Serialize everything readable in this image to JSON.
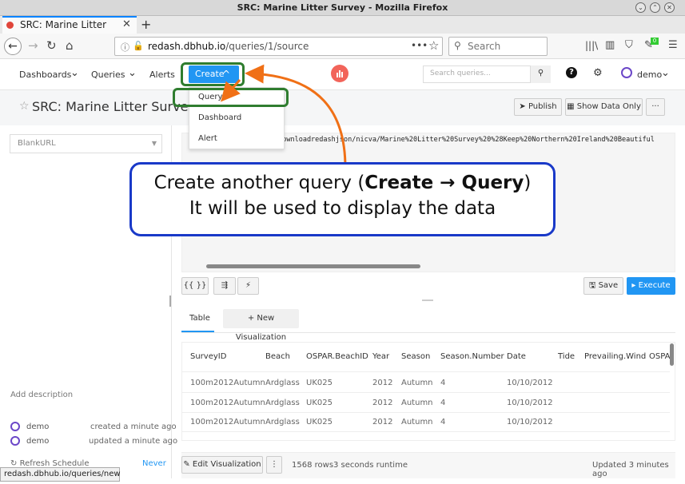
{
  "window": {
    "title": "SRC: Marine Litter Survey - Mozilla Firefox"
  },
  "browser": {
    "tab_title": "SRC: Marine Litter Survey",
    "url_host": "redash.dbhub.io",
    "url_path": "/queries/1/source",
    "search_placeholder": "Search",
    "badge": "0",
    "status_url": "redash.dbhub.io/queries/new"
  },
  "app": {
    "nav": {
      "dashboards": "Dashboards",
      "queries": "Queries",
      "alerts": "Alerts",
      "create": "Create"
    },
    "search_placeholder": "Search queries...",
    "user": "demo"
  },
  "query": {
    "title": "SRC: Marine Litter Survey",
    "publish": "Publish",
    "show_data_only": "Show Data Only",
    "more": "···",
    "data_source": "BlankURL",
    "code": "/downloadredashjson/nicva/Marine%20Litter%20Survey%20%28Keep%20Northern%20Ireland%20Beautiful",
    "params_btn": "{{ }}",
    "save": "Save",
    "execute": "Execute",
    "add_description": "Add description",
    "created_by": "demo",
    "created_when": "created a minute ago",
    "updated_by": "demo",
    "updated_when": "updated a minute ago",
    "refresh_schedule": "Refresh Schedule",
    "refresh_value": "Never"
  },
  "create_menu": {
    "items": [
      "Query",
      "Dashboard",
      "Alert"
    ]
  },
  "results": {
    "tab": "Table",
    "new_vis": "+ New Visualization",
    "columns": [
      "SurveyID",
      "Beach",
      "OSPAR.BeachID",
      "Year",
      "Season",
      "Season.Number",
      "Date",
      "Tide",
      "Prevailing.Wind",
      "OSPA"
    ],
    "rows": [
      [
        "100m2012Autumn",
        "Ardglass",
        "UK025",
        "2012",
        "Autumn",
        "4",
        "10/10/2012",
        "",
        "",
        ""
      ],
      [
        "100m2012Autumn",
        "Ardglass",
        "UK025",
        "2012",
        "Autumn",
        "4",
        "10/10/2012",
        "",
        "",
        ""
      ],
      [
        "100m2012Autumn",
        "Ardglass",
        "UK025",
        "2012",
        "Autumn",
        "4",
        "10/10/2012",
        "",
        "",
        ""
      ]
    ],
    "edit_vis": "Edit Visualization",
    "rows_count": "1568 rows",
    "runtime": "3 seconds runtime",
    "updated": "Updated 3 minutes ago"
  },
  "callout": {
    "line1_prefix": "Create another query (",
    "line1_bold": "Create → Query",
    "line1_suffix": ")",
    "line2": "It will be used to display the data"
  },
  "colors": {
    "primary": "#2196f3",
    "highlight": "#2f7d2f",
    "arrow": "#f07016",
    "callout_border": "#1939c8"
  }
}
